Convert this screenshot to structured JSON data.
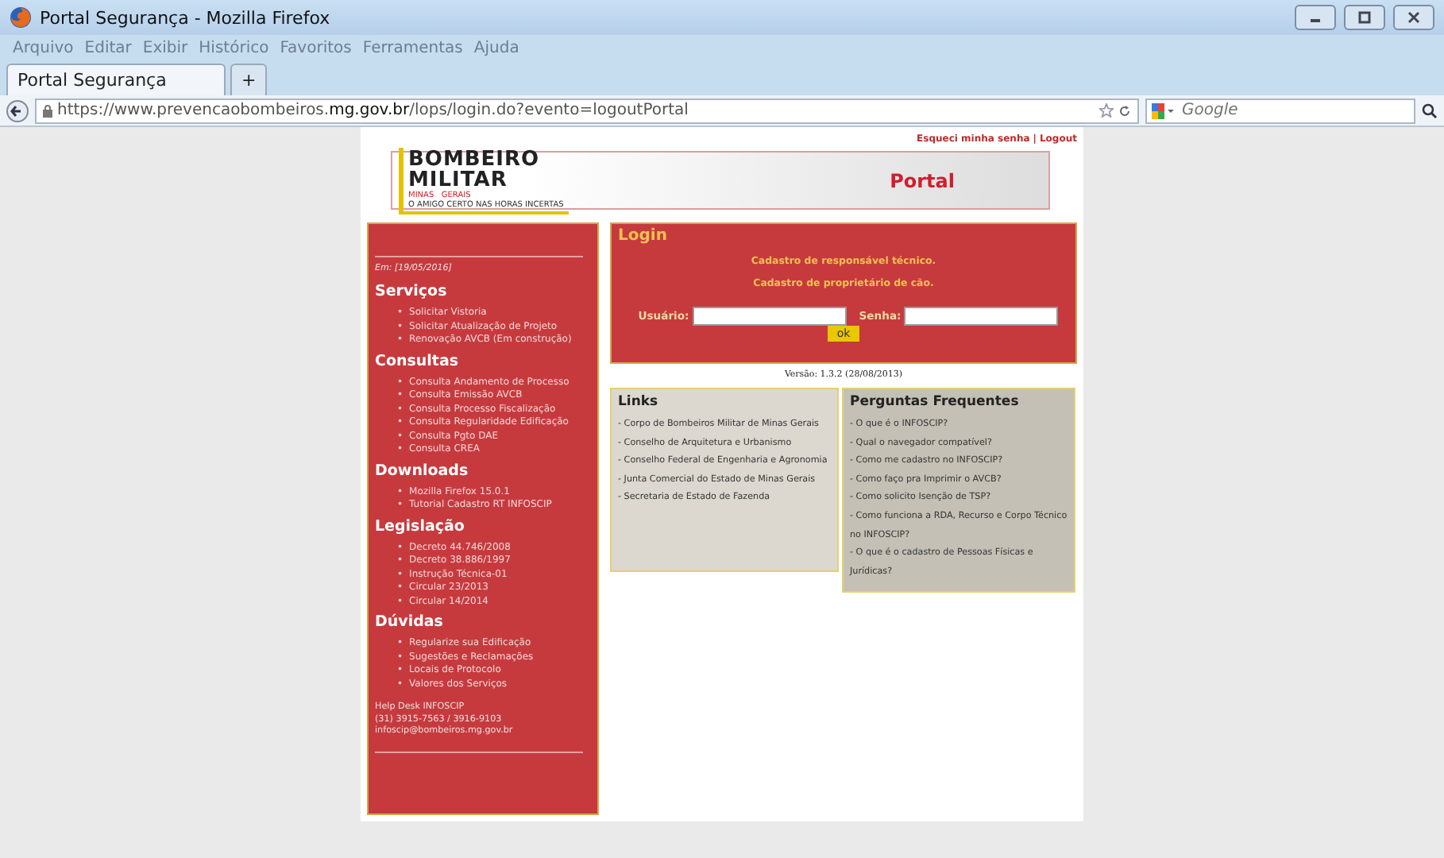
{
  "window": {
    "title": "Portal Segurança - Mozilla Firefox"
  },
  "menu": [
    "Arquivo",
    "Editar",
    "Exibir",
    "Histórico",
    "Favoritos",
    "Ferramentas",
    "Ajuda"
  ],
  "tabs": [
    {
      "label": "Portal Segurança",
      "selected": true
    },
    {
      "label": "+",
      "selected": false
    }
  ],
  "address": {
    "prefix": "https://www.prevencaobombeiros.",
    "domain": "mg.gov.br",
    "suffix": "/lops/login.do?evento=logoutPortal"
  },
  "search": {
    "placeholder": "Google"
  },
  "top_links": [
    "Esqueci minha senha",
    "Logout"
  ],
  "top_links_separator": "|",
  "logo": {
    "line1": "BOMBEIRO",
    "line2": "MILITAR",
    "line3": "MINAS   GERAIS",
    "tagline": "O AMIGO CERTO NAS HORAS INCERTAS"
  },
  "banner_title": "Portal",
  "sidebar": {
    "date": "Em: [19/05/2016]",
    "bullet": "•",
    "sections": [
      {
        "title": "Serviços",
        "items": [
          "Solicitar Vistoria",
          "Solicitar Atualização de Projeto",
          "Renovação AVCB (Em construção)"
        ]
      },
      {
        "title": "Consultas",
        "items": [
          "Consulta Andamento de Processo",
          "Consulta Emissão AVCB",
          "Consulta Processo Fiscalização",
          "Consulta Regularidade Edificação",
          "Consulta Pgto DAE",
          "Consulta CREA"
        ]
      },
      {
        "title": "Downloads",
        "items": [
          "Mozilla Firefox 15.0.1",
          "Tutorial Cadastro RT INFOSCIP"
        ]
      },
      {
        "title": "Legislação",
        "items": [
          "Decreto 44.746/2008",
          "Decreto 38.886/1997",
          "Instrução Técnica-01",
          "Circular 23/2013",
          "Circular 14/2014"
        ]
      },
      {
        "title": "Dúvidas",
        "items": [
          "Regularize sua Edificação",
          "Sugestões e Reclamações",
          "Locais de Protocolo",
          "Valores dos Serviços"
        ]
      }
    ],
    "helpdesk": [
      "Help Desk INFOSCIP",
      "(31) 3915-7563 / 3916-9103",
      "infoscip@bombeiros.mg.gov.br"
    ]
  },
  "login": {
    "title": "Login",
    "links": [
      "Cadastro de responsável técnico.",
      "Cadastro de proprietário de cão."
    ],
    "user_label": "Usuário:",
    "password_label": "Senha:",
    "button": "ok"
  },
  "version": "Versão: 1.3.2 (28/08/2013)",
  "links": {
    "title": "Links",
    "items": [
      "- Corpo de Bombeiros Militar de Minas Gerais",
      "- Conselho de Arquitetura e Urbanismo",
      "- Conselho Federal de Engenharia e Agronomia",
      "- Junta Comercial do Estado de Minas Gerais",
      "- Secretaria de Estado de Fazenda"
    ]
  },
  "faq": {
    "title": "Perguntas Frequentes",
    "items": [
      "- O que é o INFOSCIP?",
      "- Qual o navegador compatível?",
      "- Como me cadastro no INFOSCIP?",
      "- Como faço pra Imprimir o AVCB?",
      "- Como solicito Isenção de TSP?",
      "- Como funciona a RDA, Recurso e Corpo Técnico no INFOSCIP?",
      "- O que é o cadastro de Pessoas Físicas e Jurídicas?"
    ]
  }
}
